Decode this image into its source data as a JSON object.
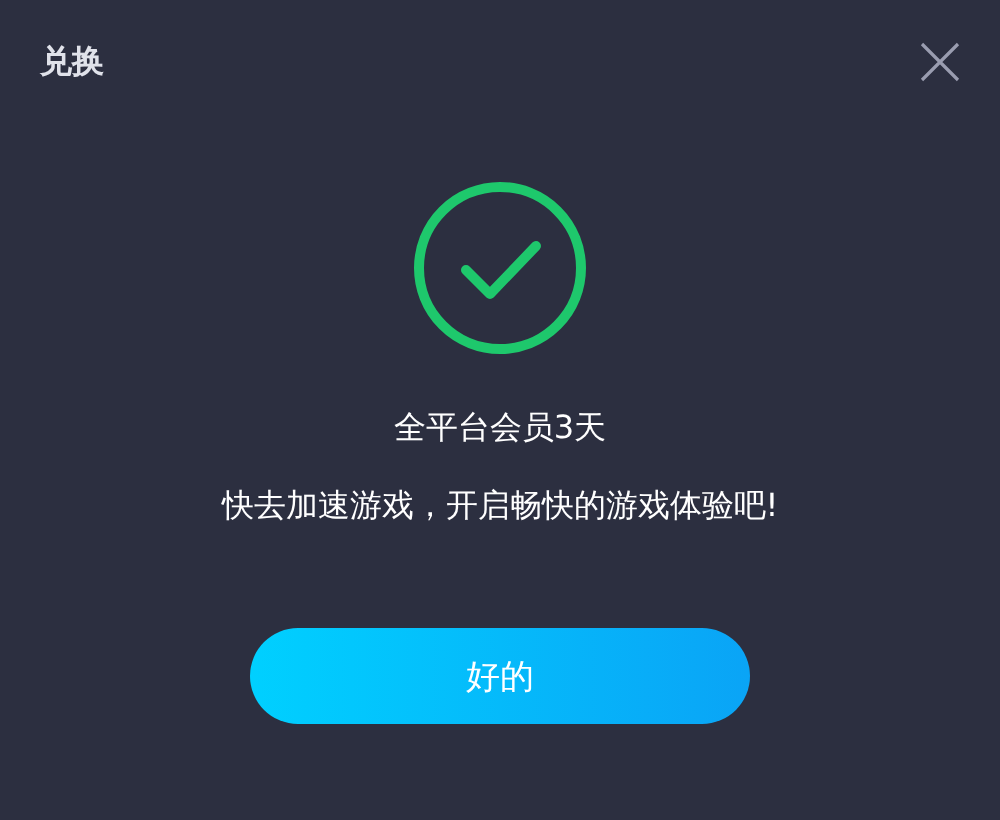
{
  "dialog": {
    "title": "兑换",
    "message": "全平台会员3天",
    "detail": "快去加速游戏，开启畅快的游戏体验吧!",
    "button": "好的"
  }
}
